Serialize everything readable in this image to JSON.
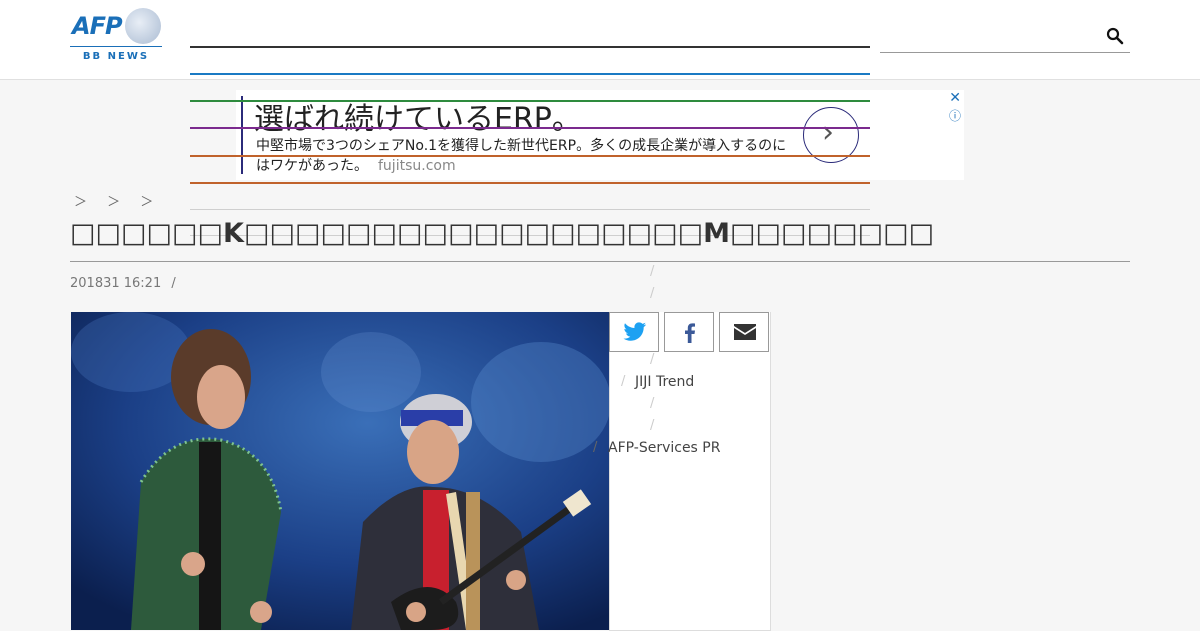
{
  "header": {
    "logo_text": "AFP",
    "logo_subtext": "BB NEWS",
    "search_placeholder": ""
  },
  "ad": {
    "headline": "選ばれ続けているERP。",
    "subtext": "中堅市場で3つのシェアNo.1を獲得した新世代ERP。多くの成長企業が導入するのにはワケがあった。",
    "domain": "fujitsu.com",
    "close_label": "✕",
    "info_label": "ⓘ"
  },
  "breadcrumb": "＞ ＞ ＞",
  "article": {
    "title": "□□□□□□K□□□□□□□□□□□□□□□□□□M□□□□□□□□",
    "date": "201831 16:21",
    "date_sep": "/"
  },
  "sidebar": {
    "links": [
      "JIJI Trend",
      "AFP-Services PR"
    ],
    "slash": "/"
  },
  "colors": {
    "nav_lines": [
      "#333333",
      "#1a7ac4",
      "#2e8b3e",
      "#7b2a8e",
      "#c0622b",
      "#c0622b"
    ],
    "brand": "#1a6fb8",
    "ad_accent": "#2b2b7a"
  },
  "share_icons": [
    "twitter-icon",
    "facebook-icon",
    "email-icon"
  ]
}
